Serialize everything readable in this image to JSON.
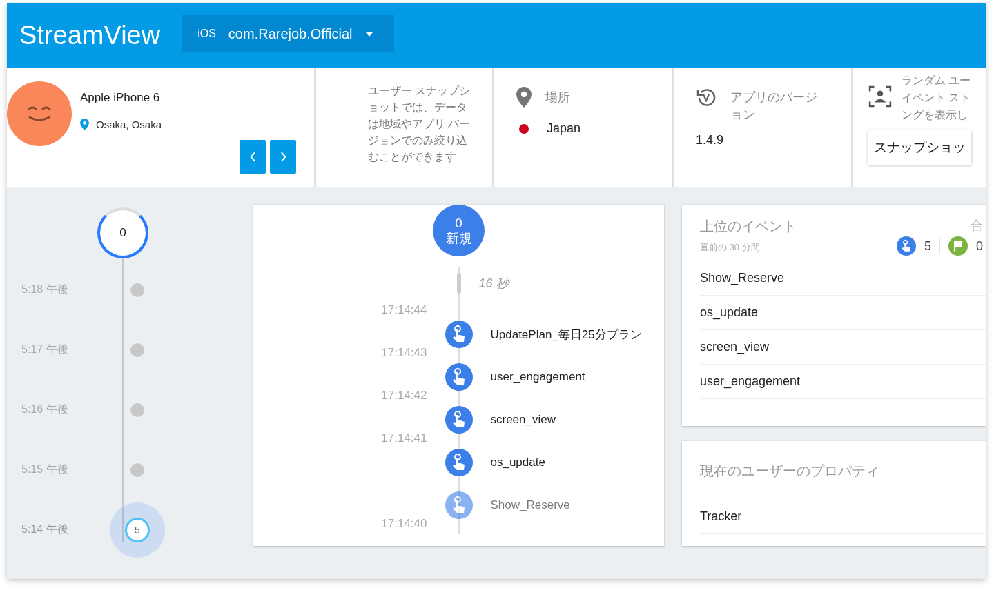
{
  "header": {
    "brand": "StreamView",
    "app_picker": {
      "platform": "iOS",
      "app_id": "com.Rarejob.Official"
    }
  },
  "device": {
    "name": "Apple iPhone 6",
    "location": "Osaka, Osaka"
  },
  "snapshot_note": "ユーザー スナップショットでは、データは地域やアプリ バージョンでのみ絞り込むことができます",
  "location": {
    "label": "場所",
    "value": "Japan"
  },
  "app_version": {
    "label": "アプリのバージョン",
    "value": "1.4.9"
  },
  "random_user": {
    "label_lines": [
      "ランダム ユー",
      "イベント スト",
      "ングを表示し"
    ],
    "button": "スナップショッ"
  },
  "minute_timeline": {
    "current_count": "0",
    "minutes": [
      {
        "time": "5:18 午後",
        "kind": "dot"
      },
      {
        "time": "5:17 午後",
        "kind": "dot"
      },
      {
        "time": "5:16 午後",
        "kind": "dot"
      },
      {
        "time": "5:15 午後",
        "kind": "dot"
      },
      {
        "time": "5:14 午後",
        "kind": "bubble",
        "count": "5"
      }
    ]
  },
  "event_stream": {
    "new_count": "0",
    "new_label": "新規",
    "elapsed": "16 秒",
    "events": [
      {
        "time": "17:14:44",
        "name": "UpdatePlan_毎日25分プラン",
        "faded": false
      },
      {
        "time": "17:14:43",
        "name": "user_engagement",
        "faded": false
      },
      {
        "time": "17:14:42",
        "name": "screen_view",
        "faded": false
      },
      {
        "time": "17:14:41",
        "name": "os_update",
        "faded": false
      },
      {
        "time": "17:14:40",
        "name": "Show_Reserve",
        "faded": true
      }
    ]
  },
  "top_events": {
    "title": "上位のイベント",
    "subtitle": "直前の 30 分間",
    "corner_text": "合",
    "event_count": "5",
    "conversion_count": "0",
    "items": [
      "Show_Reserve",
      "os_update",
      "screen_view",
      "user_engagement"
    ]
  },
  "user_properties": {
    "title": "現在のユーザーのプロパティ",
    "items": [
      "Tracker"
    ]
  }
}
